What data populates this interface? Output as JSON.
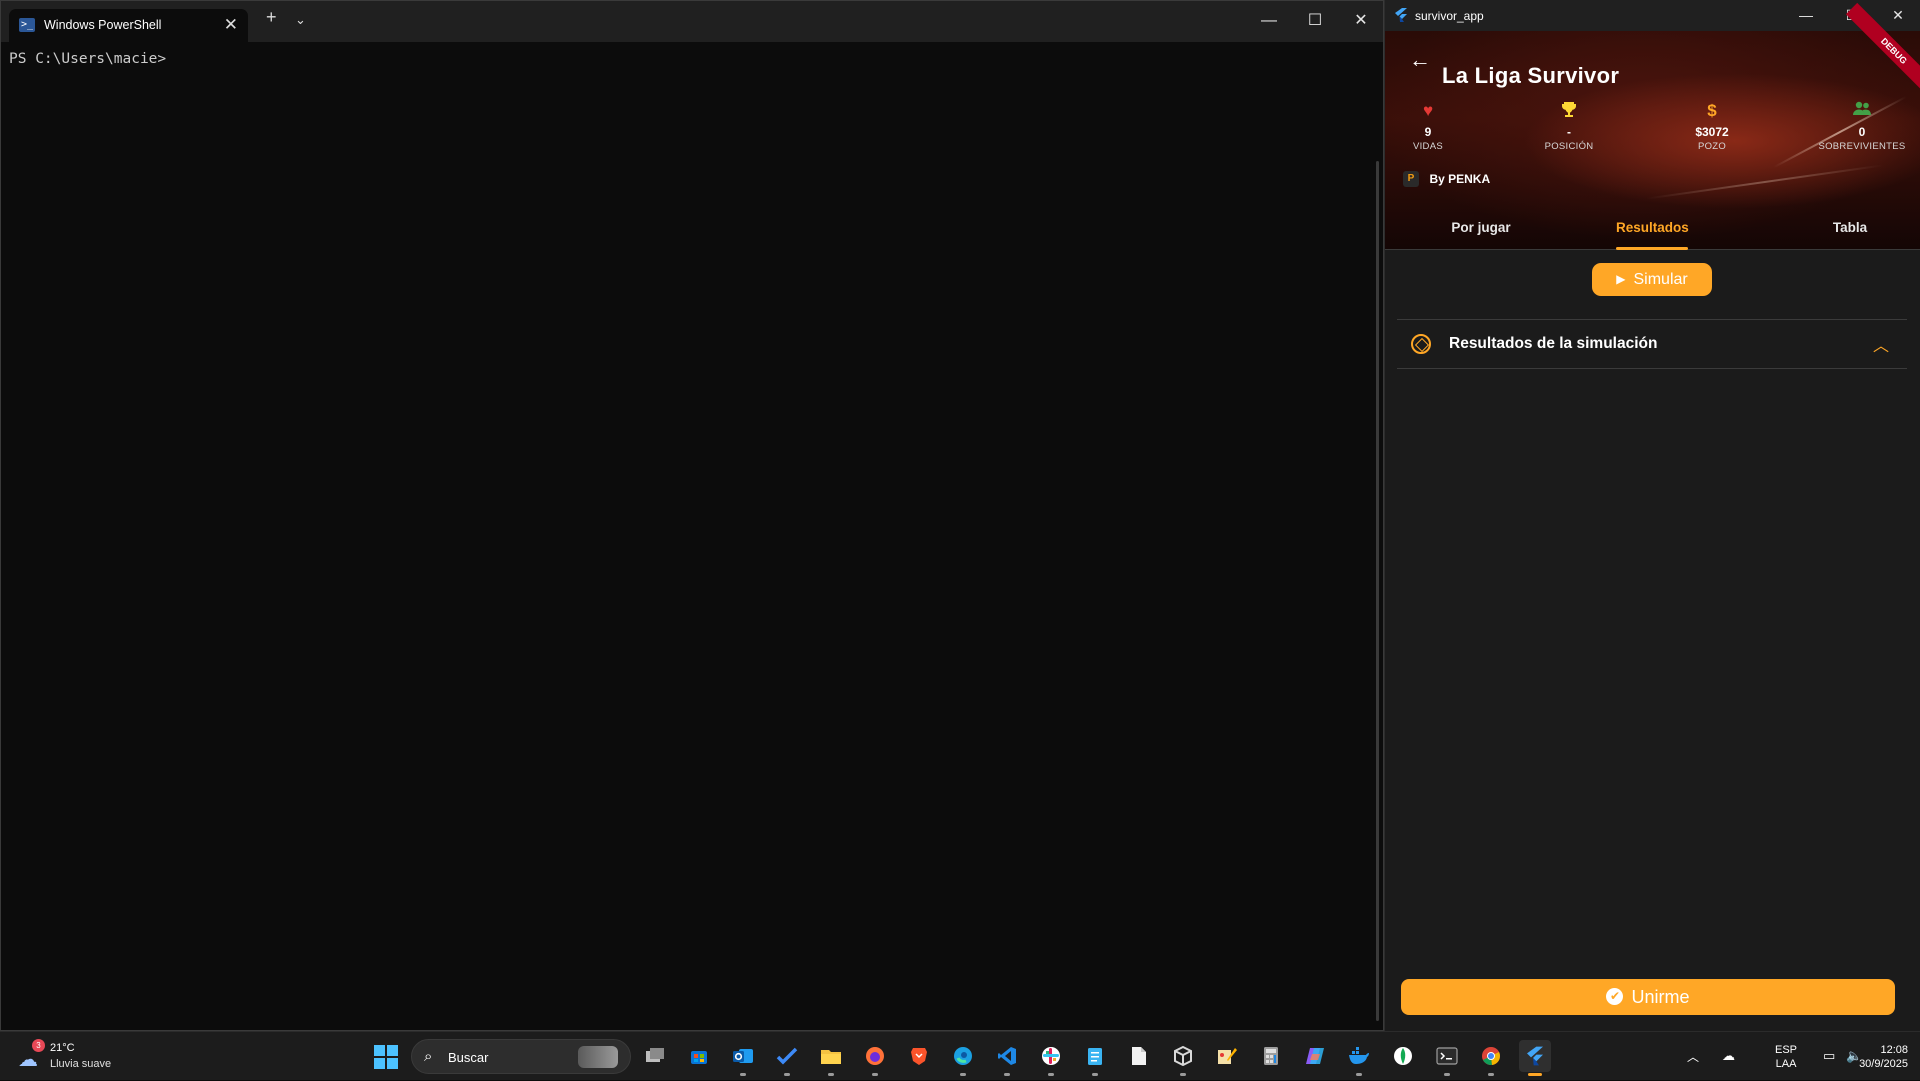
{
  "powershell": {
    "tab_title": "Windows PowerShell",
    "prompt": "PS C:\\Users\\macie>"
  },
  "app": {
    "window_title": "survivor_app",
    "debug_label": "DEBUG",
    "league_title": "La Liga Survivor",
    "stats": [
      {
        "icon": "heart-icon",
        "value": "9",
        "label": "VIDAS",
        "color": "#e53935"
      },
      {
        "icon": "trophy-icon",
        "value": "-",
        "label": "POSICIÓN",
        "color": "#fdd835"
      },
      {
        "icon": "dollar-icon",
        "value": "$3072",
        "label": "POZO",
        "color": "#ffa726"
      },
      {
        "icon": "people-icon",
        "value": "0",
        "label": "SOBREVIVIENTES",
        "color": "#43a047"
      }
    ],
    "by_label": "By PENKA",
    "tabs": [
      {
        "label": "Por jugar",
        "active": false
      },
      {
        "label": "Resultados",
        "active": true
      },
      {
        "label": "Tabla",
        "active": false
      }
    ],
    "simulate_label": "Simular",
    "results_title": "Resultados de la simulación",
    "join_label": "Unirme",
    "accent_color": "#ffa726"
  },
  "taskbar": {
    "weather_temp": "21°C",
    "weather_condition": "Lluvia suave",
    "weather_badge": "3",
    "search_placeholder": "Buscar",
    "language_top": "ESP",
    "language_bottom": "LAA",
    "time": "12:08",
    "date": "30/9/2025",
    "apps": [
      "task-view",
      "microsoft-store",
      "outlook",
      "todo",
      "file-explorer",
      "firefox",
      "brave",
      "edge",
      "vscode",
      "slack",
      "notepad",
      "file",
      "virtualbox",
      "paint",
      "calculator",
      "copilot",
      "docker",
      "mongodb-compass",
      "terminal",
      "chrome",
      "flutter"
    ]
  }
}
